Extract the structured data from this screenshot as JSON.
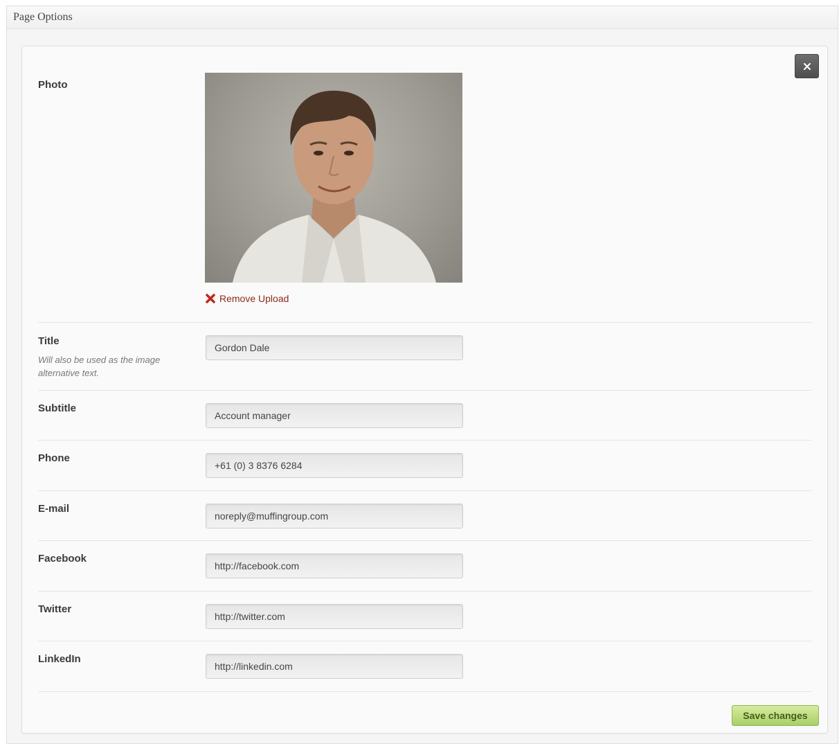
{
  "metabox": {
    "title": "Page Options"
  },
  "colors": {
    "save_button": "#b9da7c",
    "close_button": "#5c5c5c",
    "remove_link": "#8b2a1c"
  },
  "photo": {
    "label": "Photo",
    "remove_label": "Remove Upload"
  },
  "fields": {
    "title": {
      "label": "Title",
      "description": "Will also be used as the image alternative text.",
      "value": "Gordon Dale"
    },
    "subtitle": {
      "label": "Subtitle",
      "value": "Account manager"
    },
    "phone": {
      "label": "Phone",
      "value": "+61 (0) 3 8376 6284"
    },
    "email": {
      "label": "E-mail",
      "value": "noreply@muffingroup.com"
    },
    "facebook": {
      "label": "Facebook",
      "value": "http://facebook.com"
    },
    "twitter": {
      "label": "Twitter",
      "value": "http://twitter.com"
    },
    "linkedin": {
      "label": "LinkedIn",
      "value": "http://linkedin.com"
    }
  },
  "actions": {
    "save_label": "Save changes",
    "close_icon": "close-icon"
  }
}
